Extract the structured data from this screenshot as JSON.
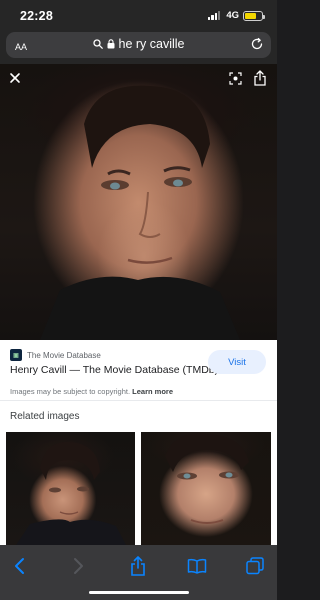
{
  "status": {
    "time": "22:28",
    "network": "4G"
  },
  "url_bar": {
    "text_size_label": "AA",
    "url_text": "he ry caville"
  },
  "result": {
    "source_name": "The Movie Database",
    "title": "Henry Cavill — The Movie Database (TMDb)",
    "visit_label": "Visit",
    "copyright_text": "Images may be subject to copyright.",
    "learn_more_label": "Learn more"
  },
  "related": {
    "heading": "Related images"
  },
  "colors": {
    "visit_button_bg": "#e8f0fe",
    "accent_blue": "#1a73e8",
    "battery": "#f2d600",
    "toolbar_icon": "#0a84ff"
  },
  "icons": {
    "hero": [
      "close-icon",
      "lens-icon",
      "share-icon"
    ],
    "toolbar": [
      "back-icon",
      "forward-icon",
      "share-icon",
      "bookmarks-icon",
      "tabs-icon"
    ]
  }
}
